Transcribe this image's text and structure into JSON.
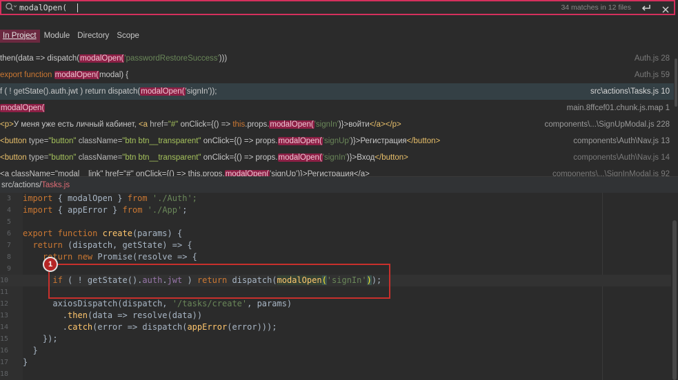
{
  "search": {
    "query": "modalOpen(",
    "match_count": "34 matches in 12 files",
    "icons": {
      "search": "search-icon",
      "enter": "enter-icon",
      "close": "close-icon"
    }
  },
  "scopes": [
    {
      "label": "In Project",
      "active": true
    },
    {
      "label": "Module",
      "active": false
    },
    {
      "label": "Directory",
      "active": false
    },
    {
      "label": "Scope",
      "active": false
    }
  ],
  "results": [
    {
      "code": [
        {
          "t": "then(data => dispatch("
        },
        {
          "t": "modalOpen(",
          "c": "hl"
        },
        {
          "t": "'passwordRestoreSuccess'",
          "c": "str"
        },
        {
          "t": ")))"
        }
      ],
      "location": "Auth.js 28"
    },
    {
      "code": [
        {
          "t": "export function ",
          "c": "kw"
        },
        {
          "t": "modalOpen(",
          "c": "hl"
        },
        {
          "t": "modal) {"
        }
      ],
      "location": "Auth.js 59"
    },
    {
      "selected": true,
      "code": [
        {
          "t": "f ( ! getState().auth.jwt ) return dispatch("
        },
        {
          "t": "modalOpen(",
          "c": "hl"
        },
        {
          "t": "'signIn'));"
        }
      ],
      "location": "src\\actions\\Tasks.js 10"
    },
    {
      "code": [
        {
          "t": "modalOpen(",
          "c": "hl"
        }
      ],
      "location": "main.8ffcef01.chunk.js.map 1",
      "dim": true
    },
    {
      "code": [
        {
          "t": "<p>",
          "c": "tag"
        },
        {
          "t": "У меня уже есть личный кабинет, "
        },
        {
          "t": "<a ",
          "c": "tag"
        },
        {
          "t": "href=",
          "c": "attr"
        },
        {
          "t": "\"#\" ",
          "c": "aval"
        },
        {
          "t": "onClick={() => "
        },
        {
          "t": "this",
          "c": "kw"
        },
        {
          "t": ".props."
        },
        {
          "t": "modalOpen(",
          "c": "hl"
        },
        {
          "t": "'signIn'",
          "c": "str"
        },
        {
          "t": ")}>войти"
        },
        {
          "t": "</a></p>",
          "c": "tag"
        }
      ],
      "location": "components\\...\\SignUpModal.js 228",
      "dim": true
    },
    {
      "code": [
        {
          "t": "<button ",
          "c": "tag"
        },
        {
          "t": "type=",
          "c": "attr"
        },
        {
          "t": "\"button\" ",
          "c": "aval"
        },
        {
          "t": "className=",
          "c": "attr"
        },
        {
          "t": "\"btn btn__transparent\" ",
          "c": "aval"
        },
        {
          "t": "onClick={() => props."
        },
        {
          "t": "modalOpen(",
          "c": "hl"
        },
        {
          "t": "'signUp'",
          "c": "str"
        },
        {
          "t": ")}>Регистрация"
        },
        {
          "t": "</button>",
          "c": "tag"
        }
      ],
      "location": "components\\Auth\\Nav.js 13",
      "dim": true
    },
    {
      "code": [
        {
          "t": "<button ",
          "c": "tag"
        },
        {
          "t": "type=",
          "c": "attr"
        },
        {
          "t": "\"button\" ",
          "c": "aval"
        },
        {
          "t": "className=",
          "c": "attr"
        },
        {
          "t": "\"btn btn__transparent\" ",
          "c": "aval"
        },
        {
          "t": "onClick={() => props."
        },
        {
          "t": "modalOpen(",
          "c": "hl"
        },
        {
          "t": "'signIn'",
          "c": "str"
        },
        {
          "t": ")}>Вход"
        },
        {
          "t": "</button>",
          "c": "tag"
        }
      ],
      "location": "components\\Auth\\Nav.js 14"
    },
    {
      "code": [
        {
          "t": "<a className=\"modal__link\" href=\"#\" onClick={() => this.props."
        },
        {
          "t": "modalOpen(",
          "c": "hl"
        },
        {
          "t": "'signUp')}>Регистрация</a>"
        }
      ],
      "location": "components\\...\\SignInModal.js 92"
    }
  ],
  "file_path": {
    "prefix": "src/actions/",
    "file": "Tasks.js"
  },
  "editor": {
    "lines": [
      {
        "num": "3",
        "tokens": [
          {
            "t": "import",
            "c": "kw"
          },
          {
            "t": " { modalOpen } "
          },
          {
            "t": "from",
            "c": "kw"
          },
          {
            "t": " './Auth';",
            "c": "str"
          }
        ]
      },
      {
        "num": "4",
        "tokens": [
          {
            "t": "import",
            "c": "kw"
          },
          {
            "t": " { appError } "
          },
          {
            "t": "from",
            "c": "kw"
          },
          {
            "t": " './App'",
            "c": "str"
          },
          {
            "t": ";"
          }
        ]
      },
      {
        "num": "5",
        "tokens": []
      },
      {
        "num": "6",
        "tokens": [
          {
            "t": "export function ",
            "c": "kw"
          },
          {
            "t": "create",
            "c": "fn"
          },
          {
            "t": "(params) {"
          }
        ]
      },
      {
        "num": "7",
        "tokens": [
          {
            "t": "  "
          },
          {
            "t": "return",
            "c": "kw"
          },
          {
            "t": " (dispatch, getState) => {"
          }
        ]
      },
      {
        "num": "8",
        "tokens": [
          {
            "t": "    "
          },
          {
            "t": "return new ",
            "c": "kw"
          },
          {
            "t": "Promise(resolve => {"
          }
        ]
      },
      {
        "num": "9",
        "tokens": []
      },
      {
        "num": "10",
        "current": true,
        "tokens": [
          {
            "t": "      "
          },
          {
            "t": "if",
            "c": "kw"
          },
          {
            "t": " ( ! getState()."
          },
          {
            "t": "auth",
            "c": "prop"
          },
          {
            "t": "."
          },
          {
            "t": "jwt",
            "c": "prop"
          },
          {
            "t": " ) "
          },
          {
            "t": "return",
            "c": "kw"
          },
          {
            "t": " dispatch("
          },
          {
            "t": "modalOpen",
            "c": "mhl"
          },
          {
            "t": "(",
            "c": "brk"
          },
          {
            "t": "'signIn'",
            "c": "str"
          },
          {
            "t": ")",
            "c": "brk"
          },
          {
            "t": ");"
          }
        ]
      },
      {
        "num": "11",
        "tokens": []
      },
      {
        "num": "12",
        "tokens": [
          {
            "t": "      axiosDispatch(dispatch, "
          },
          {
            "t": "'/tasks/create'",
            "c": "str"
          },
          {
            "t": ", params)"
          }
        ]
      },
      {
        "num": "13",
        "tokens": [
          {
            "t": "        ."
          },
          {
            "t": "then",
            "c": "fn"
          },
          {
            "t": "(data => resolve(data))"
          }
        ]
      },
      {
        "num": "14",
        "tokens": [
          {
            "t": "        ."
          },
          {
            "t": "catch",
            "c": "fn"
          },
          {
            "t": "(error => dispatch("
          },
          {
            "t": "appError",
            "c": "fn"
          },
          {
            "t": "(error)));"
          }
        ]
      },
      {
        "num": "15",
        "tokens": [
          {
            "t": "    });"
          }
        ]
      },
      {
        "num": "16",
        "tokens": [
          {
            "t": "  }"
          }
        ]
      },
      {
        "num": "17",
        "tokens": [
          {
            "t": "}"
          }
        ]
      },
      {
        "num": "18",
        "tokens": []
      }
    ]
  },
  "annotation": {
    "badge": "1"
  },
  "colors": {
    "accent": "#d5305d",
    "match_highlight": "#8c1f45",
    "annotation": "#c9302c"
  }
}
